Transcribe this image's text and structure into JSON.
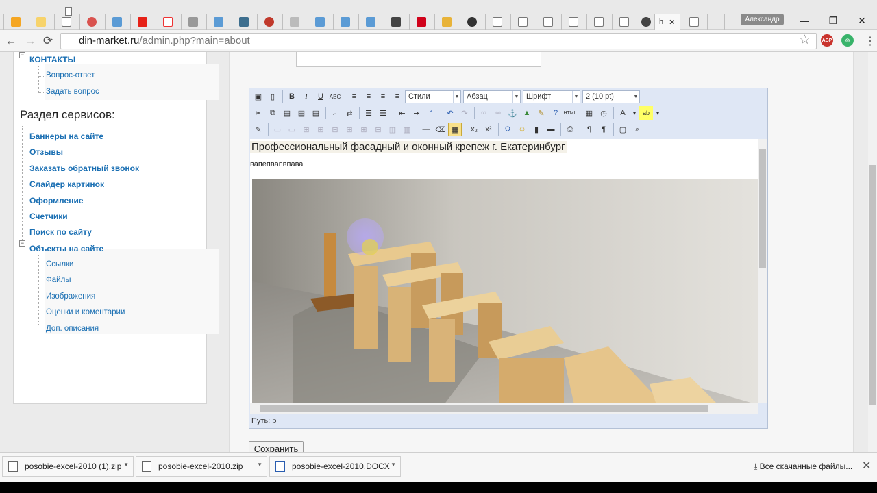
{
  "browser": {
    "active_tab_title": "h",
    "user_name": "Александр",
    "url_host": "din-market.ru",
    "url_path": "/admin.php?main=about",
    "window_minimize": "—",
    "window_maximize": "❐",
    "window_close": "✕",
    "colors": {
      "tabstrip": "#e9e9e9",
      "abp": "#c9332d",
      "green_ext": "#38b36a"
    }
  },
  "sidebar": {
    "contacts_label": "КОНТАКТЫ",
    "contacts_children": [
      "Вопрос-ответ",
      "Задать вопрос"
    ],
    "services_title": "Раздел сервисов:",
    "service_items": [
      "Баннеры на сайте",
      "Отзывы",
      "Заказать обратный звонок",
      "Слайдер картинок",
      "Оформление",
      "Счетчики",
      "Поиск по сайту"
    ],
    "objects_label": "Объекты на сайте",
    "objects_children": [
      "Ссылки",
      "Файлы",
      "Изображения",
      "Оценки и коментарии",
      "Доп. описания"
    ],
    "link_color": "#1a6fb3"
  },
  "editor": {
    "styles_select": "Стили",
    "format_select": "Абзац",
    "font_select": "Шрифт",
    "size_select": "2 (10 pt)",
    "heading_text": "Профессиональный фасадный и оконный крепеж г. Екатеринбург",
    "paragraph_text": "вапепвапвпава",
    "path_label": "Путь: p",
    "toolbar_color": "#dfe7f5"
  },
  "form": {
    "save_label": "Сохранить"
  },
  "downloads": {
    "items": [
      "posobie-excel-2010 (1).zip",
      "posobie-excel-2010.zip",
      "posobie-excel-2010.DOCX"
    ],
    "all_label": "Все скачанные файлы..."
  }
}
